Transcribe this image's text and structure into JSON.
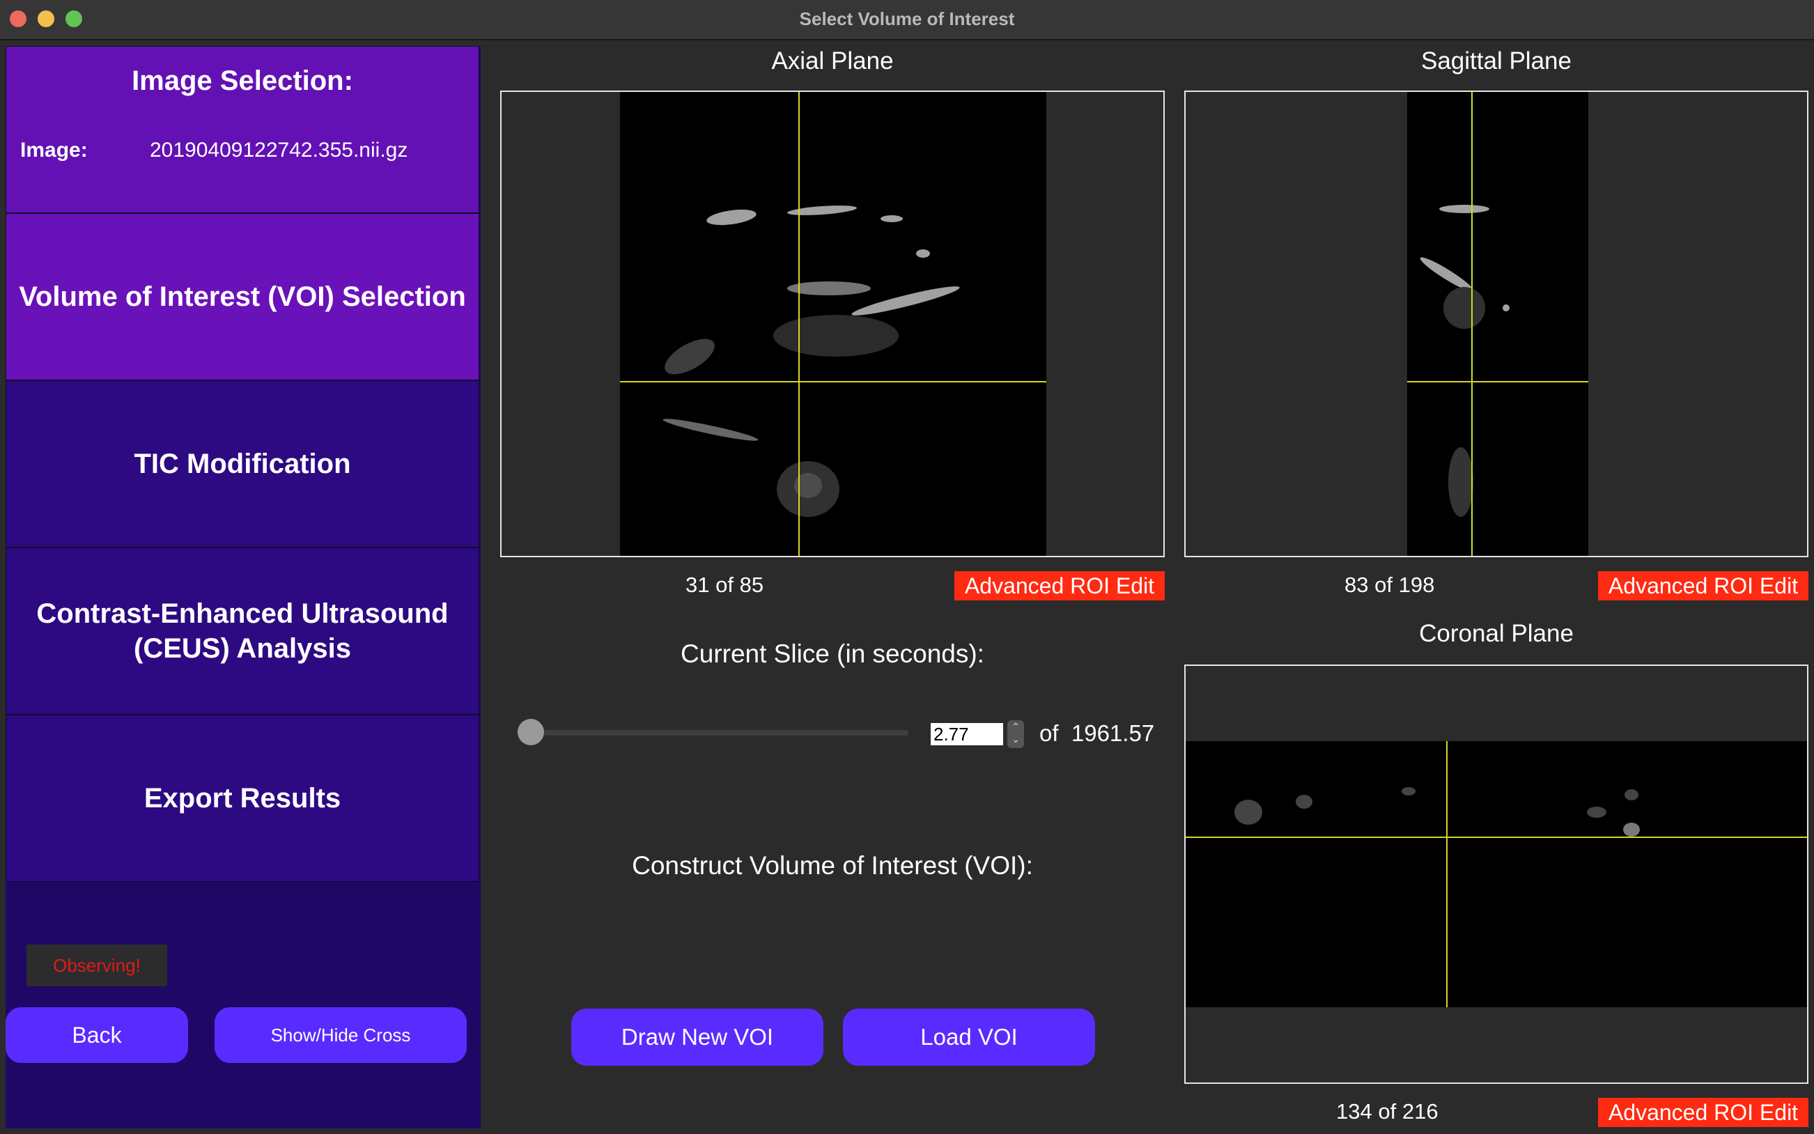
{
  "window": {
    "title": "Select Volume of Interest"
  },
  "sidebar": {
    "image_selection": {
      "heading": "Image Selection:",
      "image_label": "Image:",
      "image_value": "20190409122742.355.nii.gz"
    },
    "steps": [
      {
        "label": "Volume of Interest (VOI) Selection",
        "active": true
      },
      {
        "label": "TIC Modification",
        "active": false
      },
      {
        "label": "Contrast-Enhanced Ultrasound (CEUS) Analysis",
        "active": false
      },
      {
        "label": "Export Results",
        "active": false
      }
    ],
    "status": "Observing!",
    "back_label": "Back",
    "cross_label": "Show/Hide Cross"
  },
  "axial": {
    "title": "Axial Plane",
    "current": "31",
    "of_word": "of",
    "total": "85",
    "roi_label": "Advanced ROI Edit"
  },
  "sagittal": {
    "title": "Sagittal Plane",
    "current": "83",
    "of_word": "of",
    "total": "198",
    "roi_label": "Advanced ROI Edit"
  },
  "coronal": {
    "title": "Coronal Plane",
    "current": "134",
    "of_word": "of",
    "total": "216",
    "roi_label": "Advanced ROI Edit"
  },
  "slice": {
    "label": "Current Slice (in seconds):",
    "value": "2.77",
    "of_word": "of",
    "total": "1961.57",
    "slider_fraction": 0.0014
  },
  "voi": {
    "label": "Construct Volume of Interest (VOI):",
    "draw_label": "Draw New VOI",
    "load_label": "Load VOI"
  },
  "colors": {
    "sidebar_active": "#6a12b9",
    "sidebar_inactive": "#2d0a82",
    "button": "#5a2bff",
    "roi_button": "#ff2a12",
    "crosshair": "#d6d62a"
  },
  "icons": {
    "spin": "up-down-arrows-icon"
  }
}
